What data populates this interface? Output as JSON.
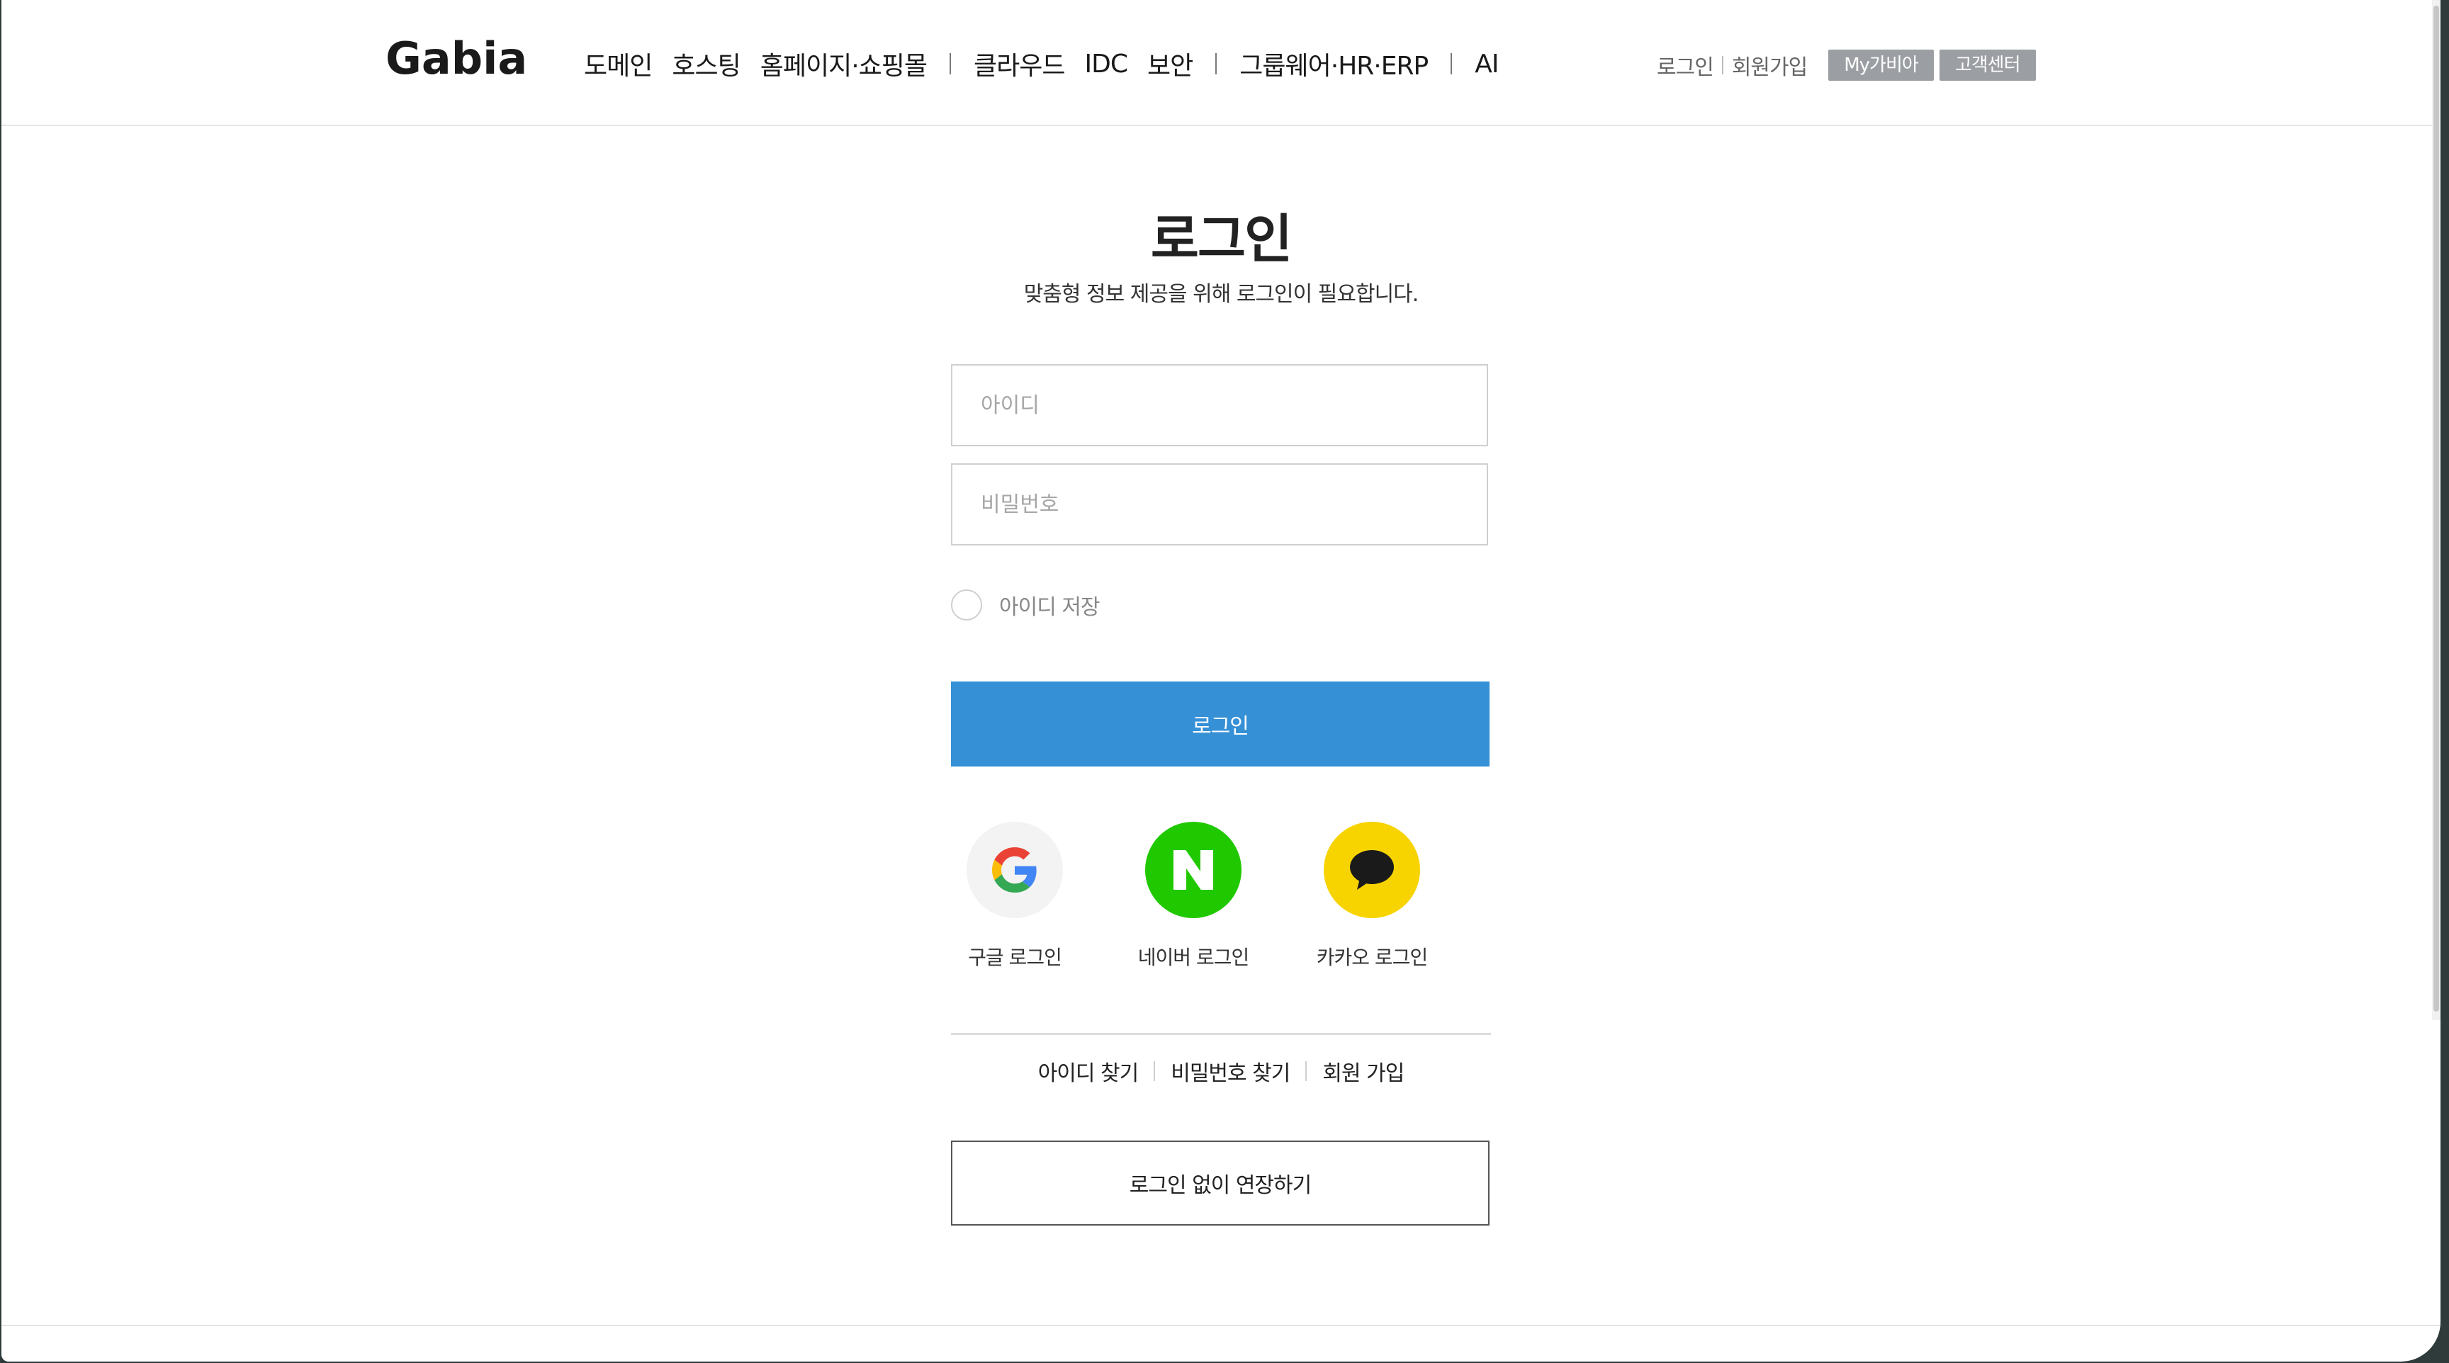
{
  "header": {
    "logo": "Gabia",
    "nav_group1": [
      "도메인",
      "호스팅",
      "홈페이지·쇼핑몰"
    ],
    "nav_group2": [
      "클라우드",
      "IDC",
      "보안"
    ],
    "nav_group3": [
      "그룹웨어·HR·ERP"
    ],
    "nav_group4": [
      "AI"
    ],
    "util": {
      "login": "로그인",
      "signup": "회원가입",
      "mygabia": "My가비아",
      "support": "고객센터"
    }
  },
  "login": {
    "title": "로그인",
    "subtitle": "맞춤형 정보 제공을 위해 로그인이 필요합니다.",
    "id_placeholder": "아이디",
    "pw_placeholder": "비밀번호",
    "save_id_label": "아이디 저장",
    "save_id_checked": false,
    "submit_label": "로그인",
    "social": {
      "google": "구글 로그인",
      "naver": "네이버 로그인",
      "kakao": "카카오 로그인"
    },
    "links": {
      "find_id": "아이디 찾기",
      "find_pw": "비밀번호 찾기",
      "join": "회원 가입"
    },
    "renew_label": "로그인 없이 연장하기"
  },
  "colors": {
    "primary": "#3590d6",
    "naver": "#20c800",
    "kakao": "#f7d300",
    "google_bg": "#f3f3f3",
    "util_button": "#9b9ea3"
  },
  "icons": {
    "google": "google-logo-icon",
    "naver": "naver-logo-icon",
    "kakao": "kakao-speech-bubble-icon"
  }
}
